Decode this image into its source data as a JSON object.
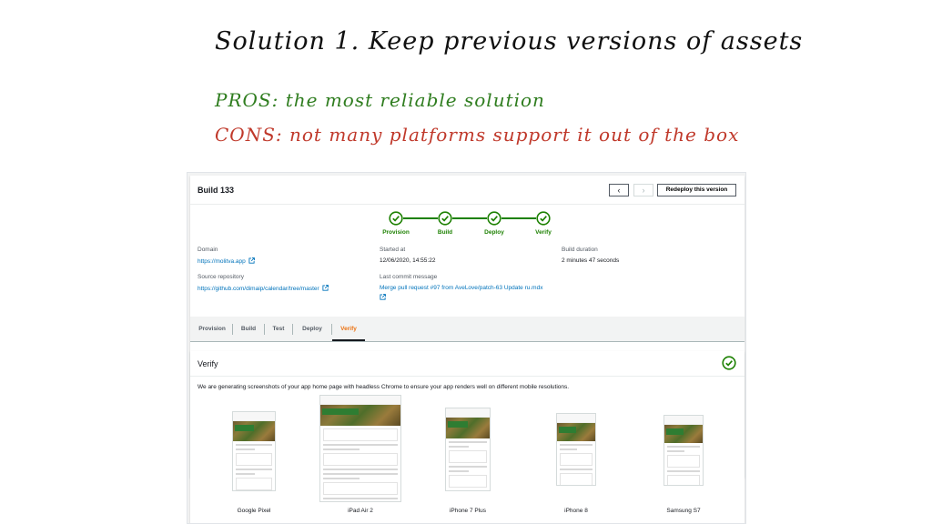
{
  "slide": {
    "title": "Solution 1. Keep previous versions of assets",
    "pros": "PROS: the most reliable solution",
    "cons": "CONS: not many platforms support it out of the box"
  },
  "build": {
    "title": "Build 133",
    "prev_symbol": "‹",
    "next_symbol": "›",
    "redeploy_label": "Redeploy this version",
    "steps": [
      "Provision",
      "Build",
      "Deploy",
      "Verify"
    ],
    "domain_label": "Domain",
    "domain_value": "https://molitva.app",
    "source_label": "Source repository",
    "source_value": "https://github.com/dimaip/calendar/tree/master",
    "started_label": "Started at",
    "started_value": "12/06/2020, 14:55:22",
    "commit_label": "Last commit message",
    "commit_value": "Merge pull request #97 from AveLove/patch-63 Update ru.mdx",
    "duration_label": "Build duration",
    "duration_value": "2 minutes 47 seconds"
  },
  "tabs": [
    "Provision",
    "Build",
    "Test",
    "Deploy",
    "Verify"
  ],
  "verify": {
    "title": "Verify",
    "description": "We are generating screenshots of your app home page with headless Chrome to ensure your app renders well on different mobile resolutions.",
    "devices": [
      "Google Pixel",
      "iPad Air 2",
      "iPhone 7 Plus",
      "iPhone 8",
      "Samsung S7"
    ]
  },
  "colors": {
    "success": "#1d8102",
    "link": "#0073bb",
    "active_tab": "#ec7211",
    "pros": "#2f7d1f",
    "cons": "#c0392b"
  }
}
